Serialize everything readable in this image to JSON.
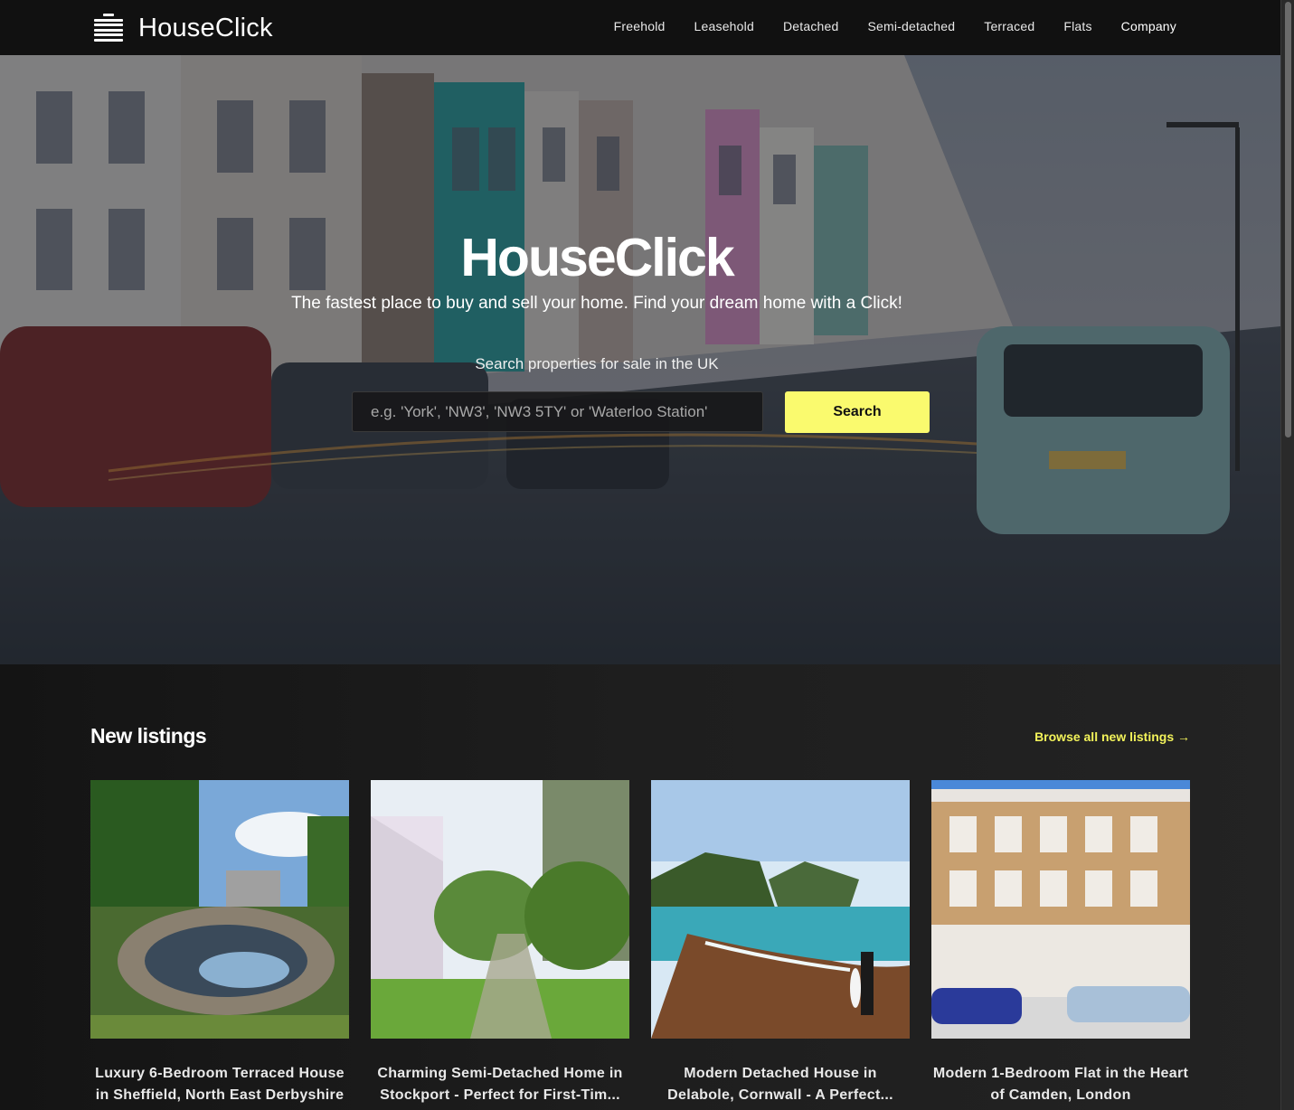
{
  "header": {
    "brand": "HouseClick",
    "nav": [
      "Freehold",
      "Leasehold",
      "Detached",
      "Semi-detached",
      "Terraced",
      "Flats",
      "Company"
    ]
  },
  "hero": {
    "title": "HouseClick",
    "subtitle": "The fastest place to buy and sell your home. Find your dream home with a Click!",
    "search_label": "Search properties for sale in the UK",
    "search_placeholder": "e.g. 'York', 'NW3', 'NW3 5TY' or 'Waterloo Station'",
    "search_button": "Search"
  },
  "listings": {
    "title": "New listings",
    "browse_link": "Browse all new listings →",
    "items": [
      {
        "title": "Luxury 6-Bedroom Terraced House in Sheffield, North East Derbyshire"
      },
      {
        "title": "Charming Semi-Detached Home in Stockport - Perfect for First-Tim..."
      },
      {
        "title": "Modern Detached House in Delabole, Cornwall - A Perfect..."
      },
      {
        "title": "Modern 1-Bedroom Flat in the Heart of Camden, London"
      }
    ]
  },
  "colors": {
    "accent": "#fafa6e",
    "link": "#f3f35a",
    "background": "#111111"
  }
}
